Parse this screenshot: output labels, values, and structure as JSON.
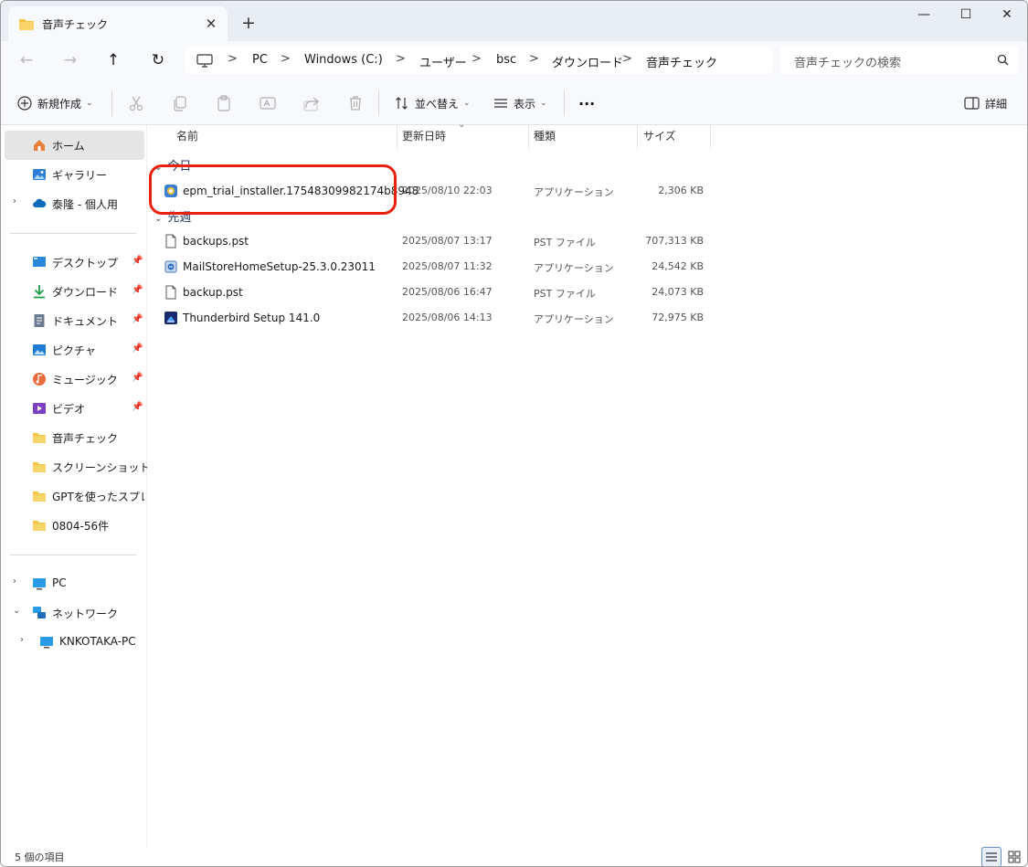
{
  "window": {
    "tab_title": "音声チェック",
    "close_tab": "✕",
    "new_tab": "+",
    "minimize": "—",
    "maximize": "☐",
    "close": "✕"
  },
  "nav": {
    "back": "←",
    "forward": "→",
    "up": "↑",
    "refresh": "↻",
    "breadcrumb": [
      "PC",
      "Windows (C:)",
      "ユーザー",
      "bsc",
      "ダウンロード",
      "音声チェック"
    ],
    "separator": ">",
    "search_placeholder": "音声チェックの検索"
  },
  "toolbar": {
    "new_label": "新規作成",
    "sort_label": "並べ替え",
    "view_label": "表示",
    "more_label": "···",
    "details_label": "詳細"
  },
  "sidebar": {
    "home": "ホーム",
    "gallery": "ギャラリー",
    "onedrive": "泰隆 - 個人用",
    "quick": [
      {
        "label": "デスクトップ",
        "icon": "desktop-icon"
      },
      {
        "label": "ダウンロード",
        "icon": "download-icon"
      },
      {
        "label": "ドキュメント",
        "icon": "document-icon"
      },
      {
        "label": "ピクチャ",
        "icon": "pictures-icon"
      },
      {
        "label": "ミュージック",
        "icon": "music-icon"
      },
      {
        "label": "ビデオ",
        "icon": "video-icon"
      },
      {
        "label": "音声チェック",
        "icon": "folder-icon"
      },
      {
        "label": "スクリーンショット",
        "icon": "folder-icon"
      },
      {
        "label": "GPTを使ったスプレッド",
        "icon": "folder-icon"
      },
      {
        "label": "0804-56件",
        "icon": "folder-icon"
      }
    ],
    "pc": "PC",
    "network": "ネットワーク",
    "network_child": "KNKOTAKA-PC"
  },
  "columns": {
    "name": "名前",
    "date": "更新日時",
    "type": "種類",
    "size": "サイズ"
  },
  "groups": {
    "today": "今日",
    "last_week": "先週"
  },
  "files": [
    {
      "name": "epm_trial_installer.17548309982174b8948",
      "date": "2025/08/10 22:03",
      "type": "アプリケーション",
      "size": "2,306 KB",
      "icon": "installer-icon"
    },
    {
      "name": "backups.pst",
      "date": "2025/08/07 13:17",
      "type": "PST ファイル",
      "size": "707,313 KB",
      "icon": "file-icon"
    },
    {
      "name": "MailStoreHomeSetup-25.3.0.23011",
      "date": "2025/08/07 11:32",
      "type": "アプリケーション",
      "size": "24,542 KB",
      "icon": "setup-icon"
    },
    {
      "name": "backup.pst",
      "date": "2025/08/06 16:47",
      "type": "PST ファイル",
      "size": "24,073 KB",
      "icon": "file-icon"
    },
    {
      "name": "Thunderbird Setup 141.0",
      "date": "2025/08/06 14:13",
      "type": "アプリケーション",
      "size": "72,975 KB",
      "icon": "thunderbird-icon"
    }
  ],
  "status": {
    "count": "5 個の項目"
  },
  "colors": {
    "accent": "#0067c0",
    "highlight_ring": "#e8200c",
    "folder": "#f6c343"
  }
}
